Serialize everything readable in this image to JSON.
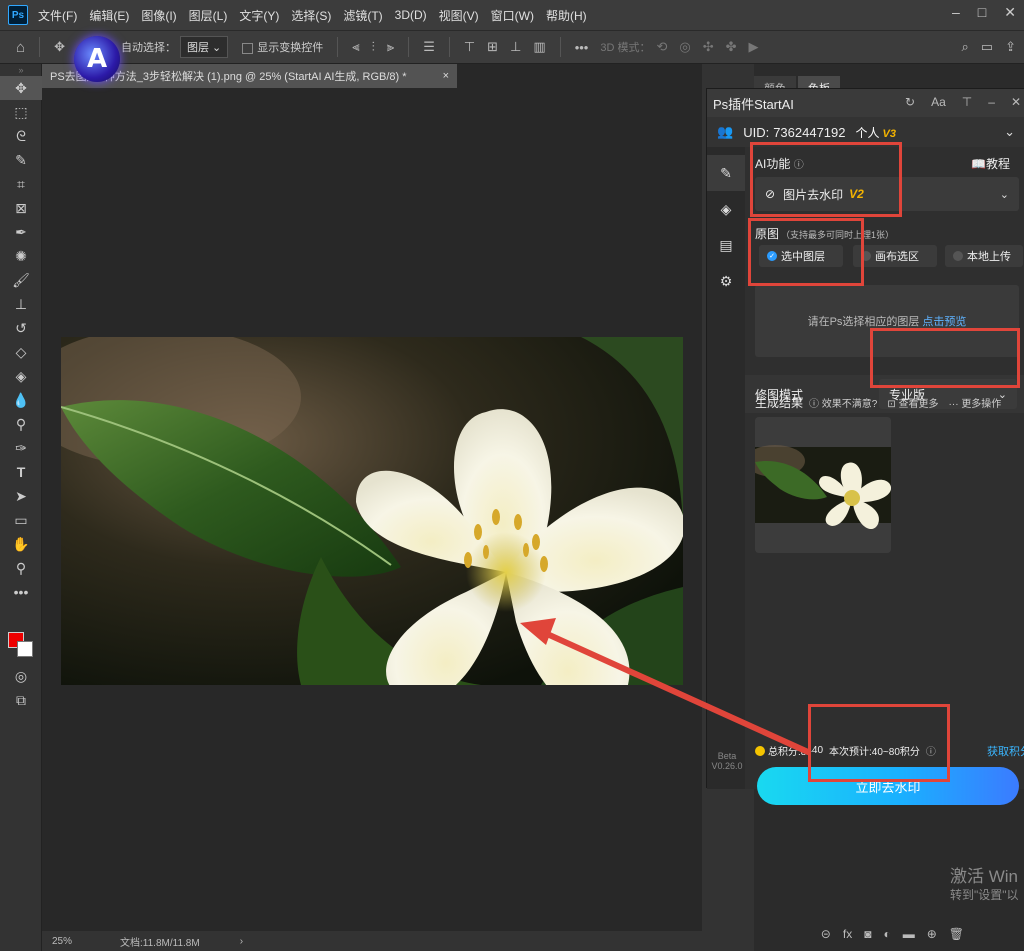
{
  "menubar": {
    "logo": "Ps",
    "items": [
      "文件(F)",
      "编辑(E)",
      "图像(I)",
      "图层(L)",
      "文字(Y)",
      "选择(S)",
      "滤镜(T)",
      "3D(D)",
      "视图(V)",
      "窗口(W)",
      "帮助(H)"
    ],
    "window_controls": [
      "–",
      "□",
      "✕"
    ]
  },
  "options_bar": {
    "auto_select_label": "自动选择：",
    "layer_select": "图层",
    "show_transform_label": "显示变换控件",
    "mode_3d_label": "3D 模式："
  },
  "document": {
    "tab_title": "PS去图片3种方法_3步轻松解决 (1).png @ 25% (StartAI AI生成, RGB/8) *",
    "close": "×",
    "zoom": "25%",
    "doc_size": "文档:11.8M/11.8M"
  },
  "right_dock": {
    "tabs": [
      "颜色",
      "色板"
    ],
    "watermark_line1": "激活 Win",
    "watermark_line2": "转到\"设置\"以"
  },
  "plugin": {
    "title": "Ps插件StartAI",
    "uid_label": "UID:",
    "uid": "7362447192",
    "tier": "个人",
    "tier_version": "V3",
    "ai_function_label": "AI功能",
    "tutorial_label": "教程",
    "function_value": "图片去水印",
    "function_version": "V2",
    "source_label": "原图",
    "source_hint": "（支持最多可同时上理1张）",
    "source_options": [
      "选中图层",
      "画布选区",
      "本地上传"
    ],
    "drop_hint": "请在Ps选择相应的图层",
    "drop_link": "点击预览",
    "mode_label": "修图模式",
    "mode_value": "专业版",
    "result_label": "生成结果",
    "result_unsatisfied": "效果不满意?",
    "result_more": "查看更多",
    "result_actions": "更多操作",
    "credits_total": "总积分:8",
    "credits_value": "440",
    "credits_estimate": "本次预计:40~80积分",
    "get_credits": "获取积分",
    "action_button": "立即去水印",
    "beta": "Beta",
    "version": "V0.26.0"
  }
}
